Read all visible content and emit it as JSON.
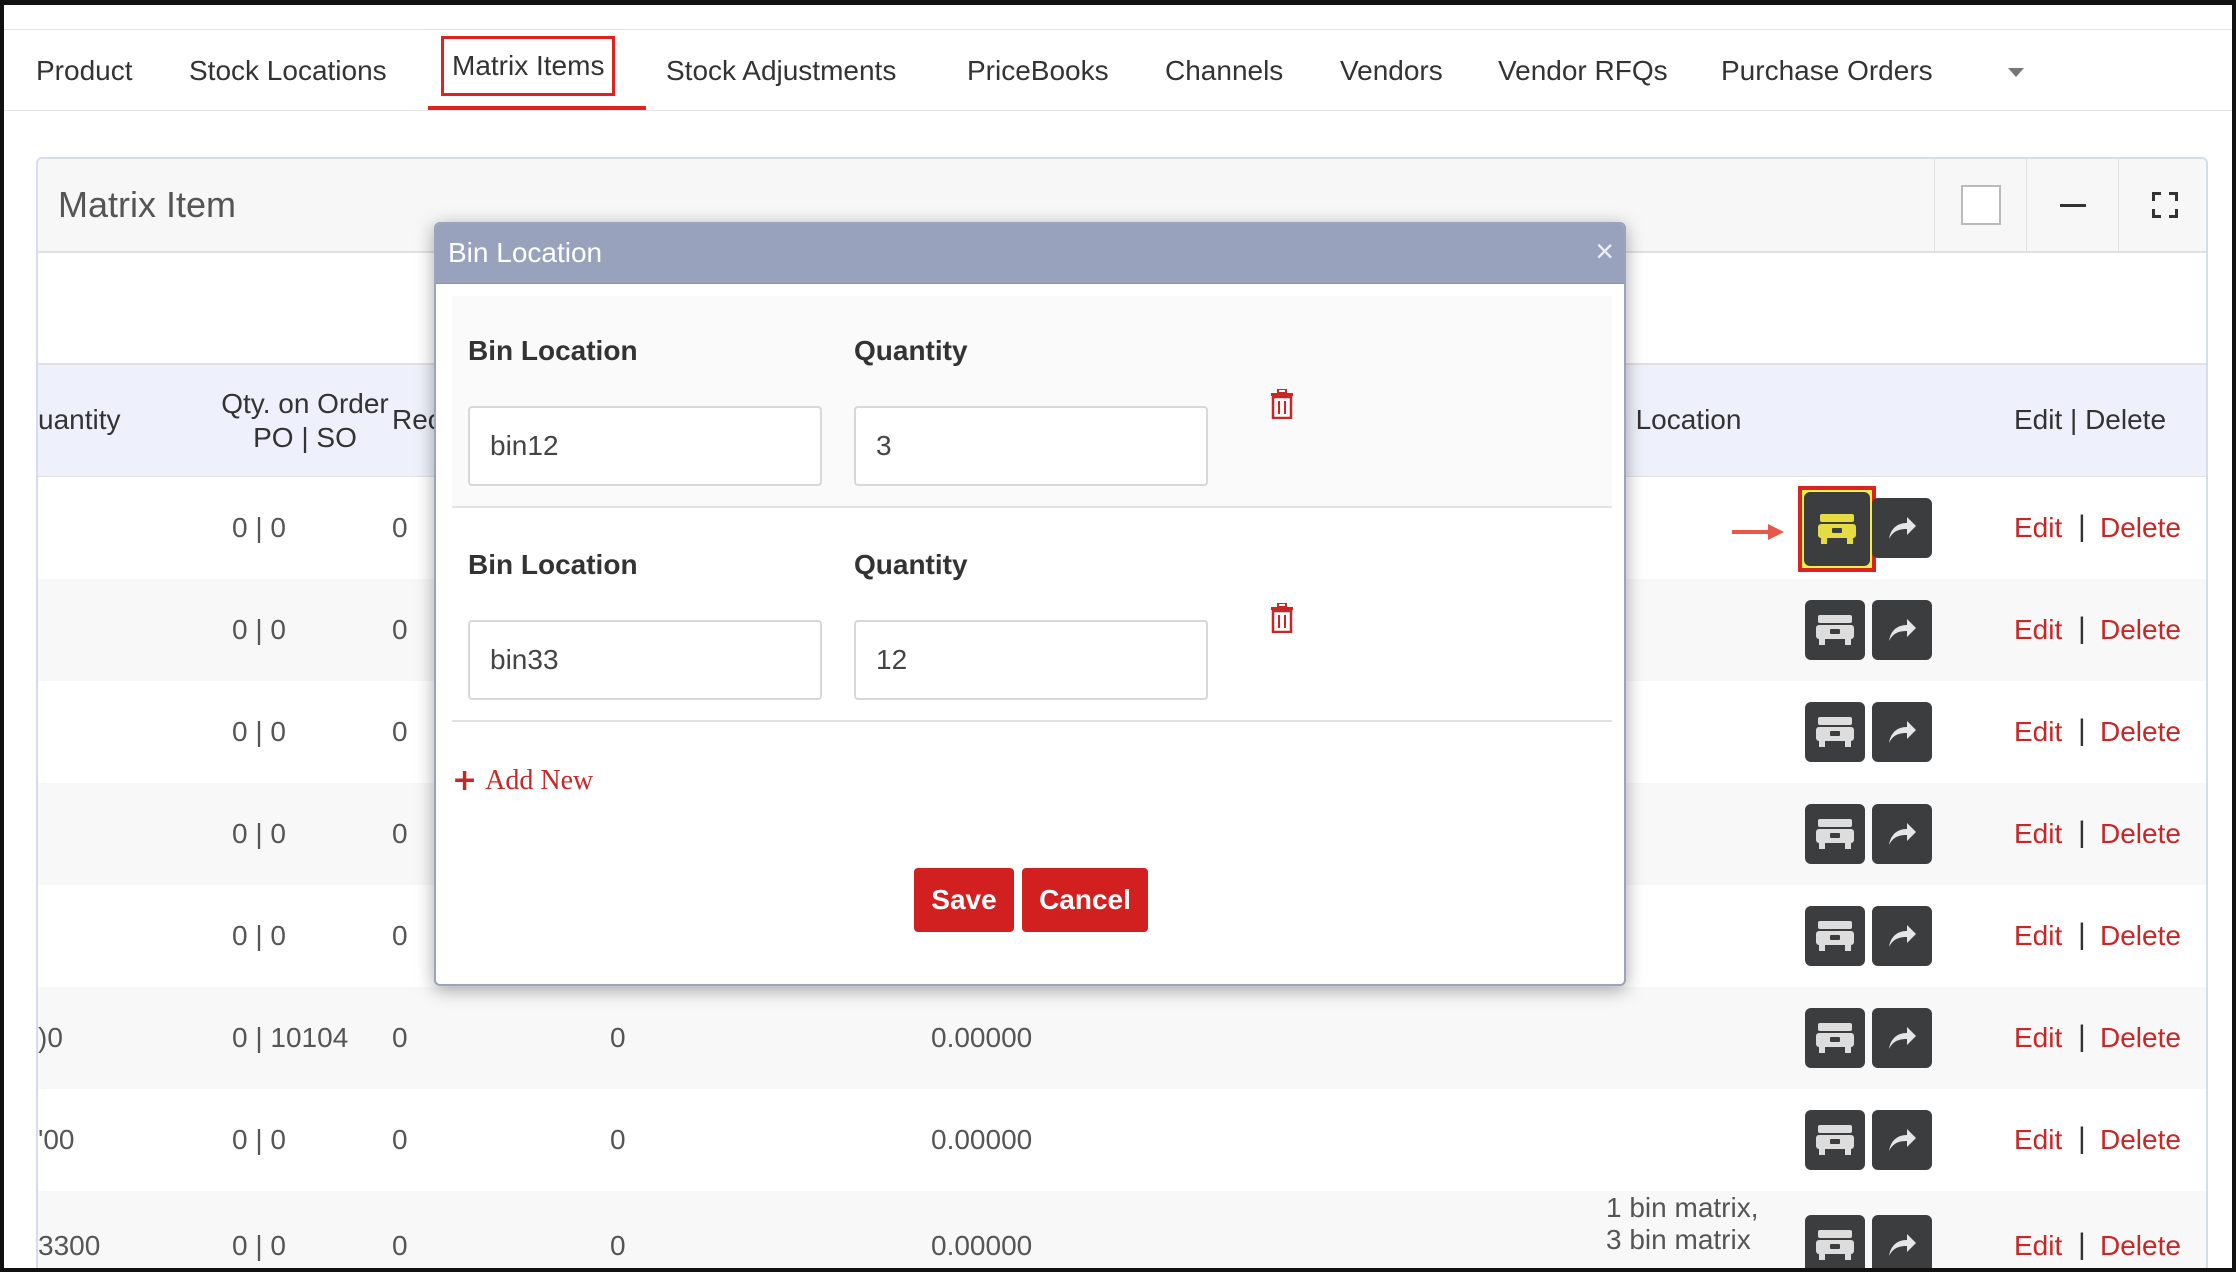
{
  "tabs": [
    {
      "label": "Product"
    },
    {
      "label": "Stock Locations"
    },
    {
      "label": "Matrix Items"
    },
    {
      "label": "Stock Adjustments"
    },
    {
      "label": "PriceBooks"
    },
    {
      "label": "Channels"
    },
    {
      "label": "Vendors"
    },
    {
      "label": "Vendor RFQs"
    },
    {
      "label": "Purchase Orders"
    }
  ],
  "active_tab": "Matrix Items",
  "panel": {
    "title": "Matrix Item"
  },
  "table": {
    "headers": {
      "quantity": "uantity",
      "qty_on_order_line1": "Qty. on Order",
      "qty_on_order_line2": "PO | SO",
      "rec": "Rec",
      "bin_location": "in Location",
      "edit_delete": "Edit | Delete"
    },
    "rows": [
      {
        "quantity": "",
        "qty_on_order": "0 | 0",
        "rec": "0",
        "col4": "",
        "col5": "",
        "bin_location": "",
        "highlighted": true
      },
      {
        "quantity": "",
        "qty_on_order": "0 | 0",
        "rec": "0",
        "col4": "",
        "col5": "",
        "bin_location": ""
      },
      {
        "quantity": "",
        "qty_on_order": "0 | 0",
        "rec": "0",
        "col4": "",
        "col5": "",
        "bin_location": ""
      },
      {
        "quantity": "",
        "qty_on_order": "0 | 0",
        "rec": "0",
        "col4": "",
        "col5": "",
        "bin_location": ""
      },
      {
        "quantity": "",
        "qty_on_order": "0 | 0",
        "rec": "0",
        "col4": "",
        "col5": "",
        "bin_location": ""
      },
      {
        "quantity": ")0",
        "qty_on_order": "0 | 10104",
        "rec": "0",
        "col4": "0",
        "col5": "0.00000",
        "bin_location": ""
      },
      {
        "quantity": "'00",
        "qty_on_order": "0 | 0",
        "rec": "0",
        "col4": "0",
        "col5": "0.00000",
        "bin_location": ""
      },
      {
        "quantity": "3300",
        "qty_on_order": "0 | 0",
        "rec": "0",
        "col4": "0",
        "col5": "0.00000",
        "bin_location": "1 bin matrix,",
        "bin_location2": "3 bin matrix"
      }
    ],
    "edit_label": "Edit",
    "delete_label": "Delete",
    "separator": "|"
  },
  "modal": {
    "title": "Bin Location",
    "close": "×",
    "bins": [
      {
        "bin_label": "Bin Location",
        "qty_label": "Quantity",
        "bin_value": "bin12",
        "qty_value": "3"
      },
      {
        "bin_label": "Bin Location",
        "qty_label": "Quantity",
        "bin_value": "bin33",
        "qty_value": "12"
      }
    ],
    "add_new": "Add New",
    "add_new_plus": "+",
    "save": "Save",
    "cancel": "Cancel"
  },
  "colors": {
    "accent_red": "#d21f1f",
    "modal_header": "#98a2bc",
    "highlight_yellow": "#f4f04a"
  }
}
